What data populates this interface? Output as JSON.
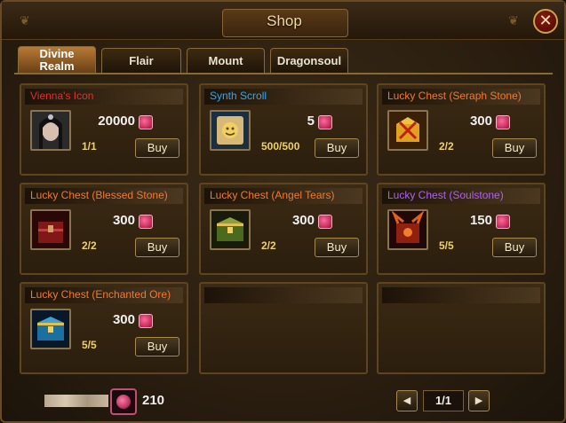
{
  "window": {
    "title": "Shop",
    "close_label": "✕"
  },
  "tabs": [
    {
      "label": "Divine Realm",
      "active": true
    },
    {
      "label": "Flair",
      "active": false
    },
    {
      "label": "Mount",
      "active": false
    },
    {
      "label": "Dragonsoul",
      "active": false
    }
  ],
  "items": [
    {
      "name": "Vienna's Icon",
      "name_color": "#e03030",
      "price": "20000",
      "stock": "1/1",
      "buy_label": "Buy",
      "icon": "portrait-icon"
    },
    {
      "name": "Synth Scroll",
      "name_color": "#30a8f0",
      "price": "5",
      "stock": "500/500",
      "buy_label": "Buy",
      "icon": "scroll-icon"
    },
    {
      "name": "Lucky Chest (Seraph Stone)",
      "name_color": "#f07a30",
      "price": "300",
      "stock": "2/2",
      "buy_label": "Buy",
      "icon": "chest-gold-icon"
    },
    {
      "name": "Lucky Chest (Blessed Stone)",
      "name_color": "#f07a30",
      "price": "300",
      "stock": "2/2",
      "buy_label": "Buy",
      "icon": "chest-red-icon"
    },
    {
      "name": "Lucky Chest (Angel Tears)",
      "name_color": "#f07a30",
      "price": "300",
      "stock": "2/2",
      "buy_label": "Buy",
      "icon": "chest-green-icon"
    },
    {
      "name": "Lucky Chest (Soulstone)",
      "name_color": "#b060f0",
      "price": "150",
      "stock": "5/5",
      "buy_label": "Buy",
      "icon": "chest-demon-icon"
    },
    {
      "name": "Lucky Chest (Enchanted Ore)",
      "name_color": "#f07a30",
      "price": "300",
      "stock": "5/5",
      "buy_label": "Buy",
      "icon": "chest-blue-icon"
    }
  ],
  "footer": {
    "currency_amount": "210",
    "currency_icon": "diamond-icon"
  },
  "pagination": {
    "page": "1/1",
    "prev_icon": "left-arrow-icon",
    "next_icon": "right-arrow-icon"
  },
  "colors": {
    "accent": "#c8a050",
    "frame": "#6b4a22"
  }
}
